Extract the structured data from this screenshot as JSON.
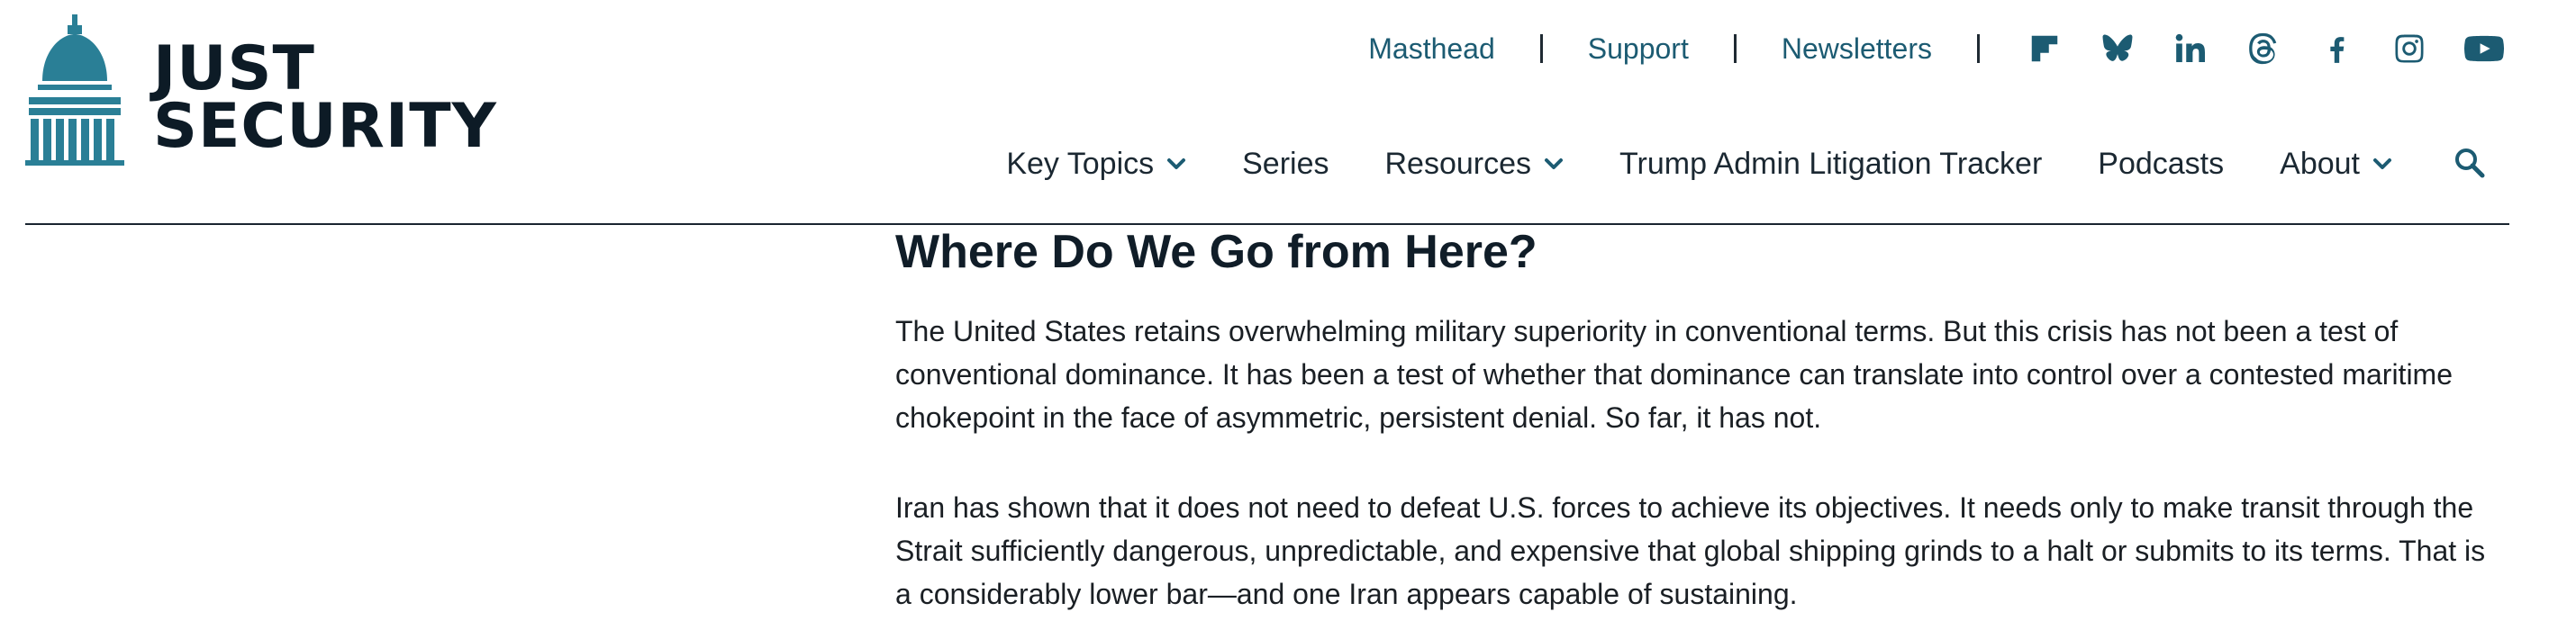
{
  "brand": {
    "line1": "JUST",
    "line2": "SECURITY",
    "logo_icon": "capitol-dome-icon",
    "color_dark": "#0d1b26",
    "color_accent": "#2a7f96"
  },
  "utility_nav": {
    "links": [
      {
        "label": "Masthead"
      },
      {
        "label": "Support"
      },
      {
        "label": "Newsletters"
      }
    ],
    "social_icons": [
      "flipboard-icon",
      "bluesky-icon",
      "linkedin-icon",
      "threads-icon",
      "facebook-icon",
      "instagram-icon",
      "youtube-icon"
    ],
    "link_color": "#1c5b72"
  },
  "main_nav": {
    "items": [
      {
        "label": "Key Topics",
        "dropdown": true
      },
      {
        "label": "Series",
        "dropdown": false
      },
      {
        "label": "Resources",
        "dropdown": true
      },
      {
        "label": "Trump Admin Litigation Tracker",
        "dropdown": false
      },
      {
        "label": "Podcasts",
        "dropdown": false
      },
      {
        "label": "About",
        "dropdown": true
      }
    ],
    "search_icon": "search-icon"
  },
  "article": {
    "heading": "Where Do We Go from Here?",
    "paragraphs": [
      "The United States retains overwhelming military superiority in conventional terms. But this crisis has not been a test of conventional dominance. It has been a test of whether that dominance can translate into control over a contested maritime chokepoint in the face of asymmetric, persistent denial. So far, it has not.",
      "Iran has shown that it does not need to defeat U.S. forces to achieve its objectives. It needs only to make transit through the Strait sufficiently dangerous, unpredictable, and expensive that global shipping grinds to a halt or submits to its terms. That is a considerably lower bar—and one Iran appears capable of sustaining."
    ]
  }
}
